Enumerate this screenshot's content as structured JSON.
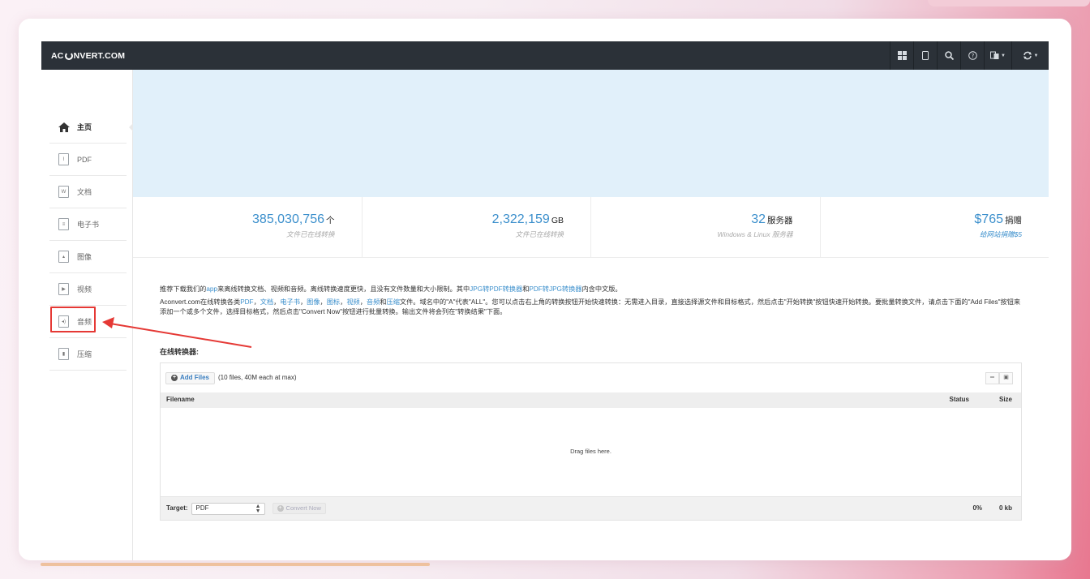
{
  "site": {
    "logo_left": "AC",
    "logo_right": "NVERT.COM"
  },
  "navbar": {
    "icons": [
      "grid-icon",
      "tablet-icon",
      "search-icon",
      "help-icon",
      "language-icon",
      "convert-icon"
    ]
  },
  "sidebar": {
    "items": [
      {
        "label": "主页",
        "icon": "home-icon",
        "active": true
      },
      {
        "label": "PDF",
        "icon": "pdf-icon"
      },
      {
        "label": "文档",
        "icon": "document-icon"
      },
      {
        "label": "电子书",
        "icon": "ebook-icon"
      },
      {
        "label": "图像",
        "icon": "image-icon"
      },
      {
        "label": "视频",
        "icon": "video-icon"
      },
      {
        "label": "音频",
        "icon": "audio-icon"
      },
      {
        "label": "压缩",
        "icon": "archive-icon"
      }
    ]
  },
  "stats": [
    {
      "value": "385,030,756",
      "unit": "个",
      "sub": "文件已在线转换"
    },
    {
      "value": "2,322,159",
      "unit": "GB",
      "sub": "文件已在线转换"
    },
    {
      "value": "32",
      "unit": "服务器",
      "sub": "Windows & Linux 服务器"
    },
    {
      "value": "$765",
      "unit": "捐赠",
      "sub": "给网站捐赠$5"
    }
  ],
  "intro": {
    "p1_a": "推荐下载我们的",
    "p1_link1": "app",
    "p1_b": "来离线转换文档、视频和音频。离线转换速度更快，且没有文件数量和大小限制。其中",
    "p1_link2": "JPG转PDF转换器",
    "p1_c": "和",
    "p1_link3": "PDF转JPG转换器",
    "p1_d": "内含中文版。",
    "p2_a": "Aconvert.com在线转换各类",
    "p2_links": [
      "PDF",
      "文档",
      "电子书",
      "图像",
      "图标",
      "视频",
      "音频",
      "压缩"
    ],
    "p2_b": "文件。域名中的\"A\"代表\"ALL\"。您可以点击右上角的转换按钮开始快速转换：无需进入目录，直接选择源文件和目标格式，然后点击\"开始转换\"按钮快速开始转换。要批量转换文件，请点击下面的\"Add Files\"按钮来添加一个或多个文件，选择目标格式，然后点击\"Convert Now\"按钮进行批量转换。输出文件将会列在\"转换结果\"下面。"
  },
  "converter": {
    "title": "在线转换器:",
    "add_files": "Add Files",
    "limit_note": "(10 files, 40M each at max)",
    "col_filename": "Filename",
    "col_status": "Status",
    "col_size": "Size",
    "drop_text": "Drag files here.",
    "target_label": "Target:",
    "target_value": "PDF",
    "convert_now": "Convert Now",
    "progress": "0%",
    "total_size": "0 kb"
  },
  "colors": {
    "navbar": "#2b3138",
    "link": "#3b8fcc",
    "banner": "#e1f0fa",
    "highlight": "#e53935"
  }
}
